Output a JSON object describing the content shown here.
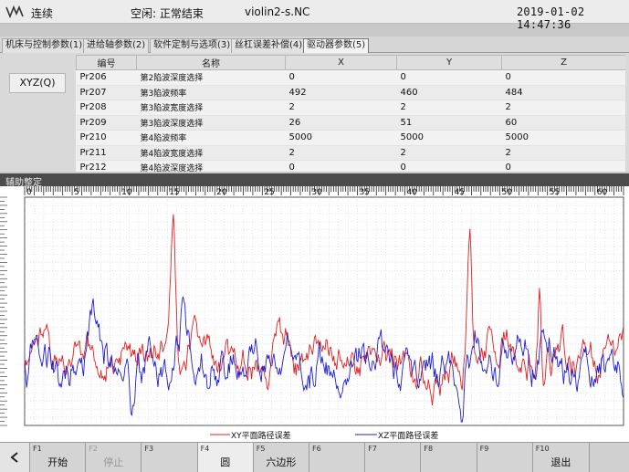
{
  "header": {
    "mode": "连续",
    "status": "空闲: 正常结束",
    "file": "violin2-s.NC",
    "datetime": "2019-01-02 14:47:36"
  },
  "tabs": [
    {
      "label": "机床与控制参数(1)",
      "active": false
    },
    {
      "label": "进给轴参数(2)",
      "active": false
    },
    {
      "label": "软件定制与选项(3)",
      "active": false
    },
    {
      "label": "丝杠误差补偿(4)",
      "active": false
    },
    {
      "label": "驱动器参数(5)",
      "active": true
    }
  ],
  "axis_button": "XYZ(Q)",
  "param_table": {
    "headers": [
      "编号",
      "名称",
      "X",
      "Y",
      "Z"
    ],
    "rows": [
      [
        "Pr206",
        "第2陷波深度选择",
        "0",
        "0",
        "0"
      ],
      [
        "Pr207",
        "第3陷波频率",
        "492",
        "460",
        "484"
      ],
      [
        "Pr208",
        "第3陷波宽度选择",
        "2",
        "2",
        "2"
      ],
      [
        "Pr209",
        "第3陷波深度选择",
        "26",
        "51",
        "60"
      ],
      [
        "Pr210",
        "第4陷波频率",
        "5000",
        "5000",
        "5000"
      ],
      [
        "Pr211",
        "第4陷波宽度选择",
        "2",
        "2",
        "2"
      ],
      [
        "Pr212",
        "第4陷波深度选择",
        "0",
        "0",
        "0"
      ]
    ]
  },
  "tuning_title": "辅助整定",
  "chart_data": {
    "type": "line",
    "x_ticks": [
      "0",
      "5",
      "10",
      "15",
      "20",
      "25",
      "30",
      "35",
      "40",
      "45",
      "50",
      "55",
      "60"
    ],
    "xlim": [
      0,
      63
    ],
    "series": [
      {
        "name": "XY平面路径误差",
        "color": "#e02020"
      },
      {
        "name": "XZ平面路径误差",
        "color": "#1f1fcf"
      }
    ]
  },
  "footer": {
    "keys": [
      {
        "code": "F1",
        "label": "开始",
        "active": false,
        "disabled": false
      },
      {
        "code": "F2",
        "label": "停止",
        "active": false,
        "disabled": true
      },
      {
        "code": "F3",
        "label": "",
        "active": false,
        "disabled": false
      },
      {
        "code": "F4",
        "label": "圆",
        "active": true,
        "disabled": false
      },
      {
        "code": "F5",
        "label": "六边形",
        "active": false,
        "disabled": false
      },
      {
        "code": "F6",
        "label": "",
        "active": false,
        "disabled": false
      },
      {
        "code": "F7",
        "label": "",
        "active": false,
        "disabled": false
      },
      {
        "code": "F8",
        "label": "",
        "active": false,
        "disabled": false
      },
      {
        "code": "F9",
        "label": "",
        "active": false,
        "disabled": false
      },
      {
        "code": "F10",
        "label": "退出",
        "active": false,
        "disabled": false
      }
    ]
  }
}
